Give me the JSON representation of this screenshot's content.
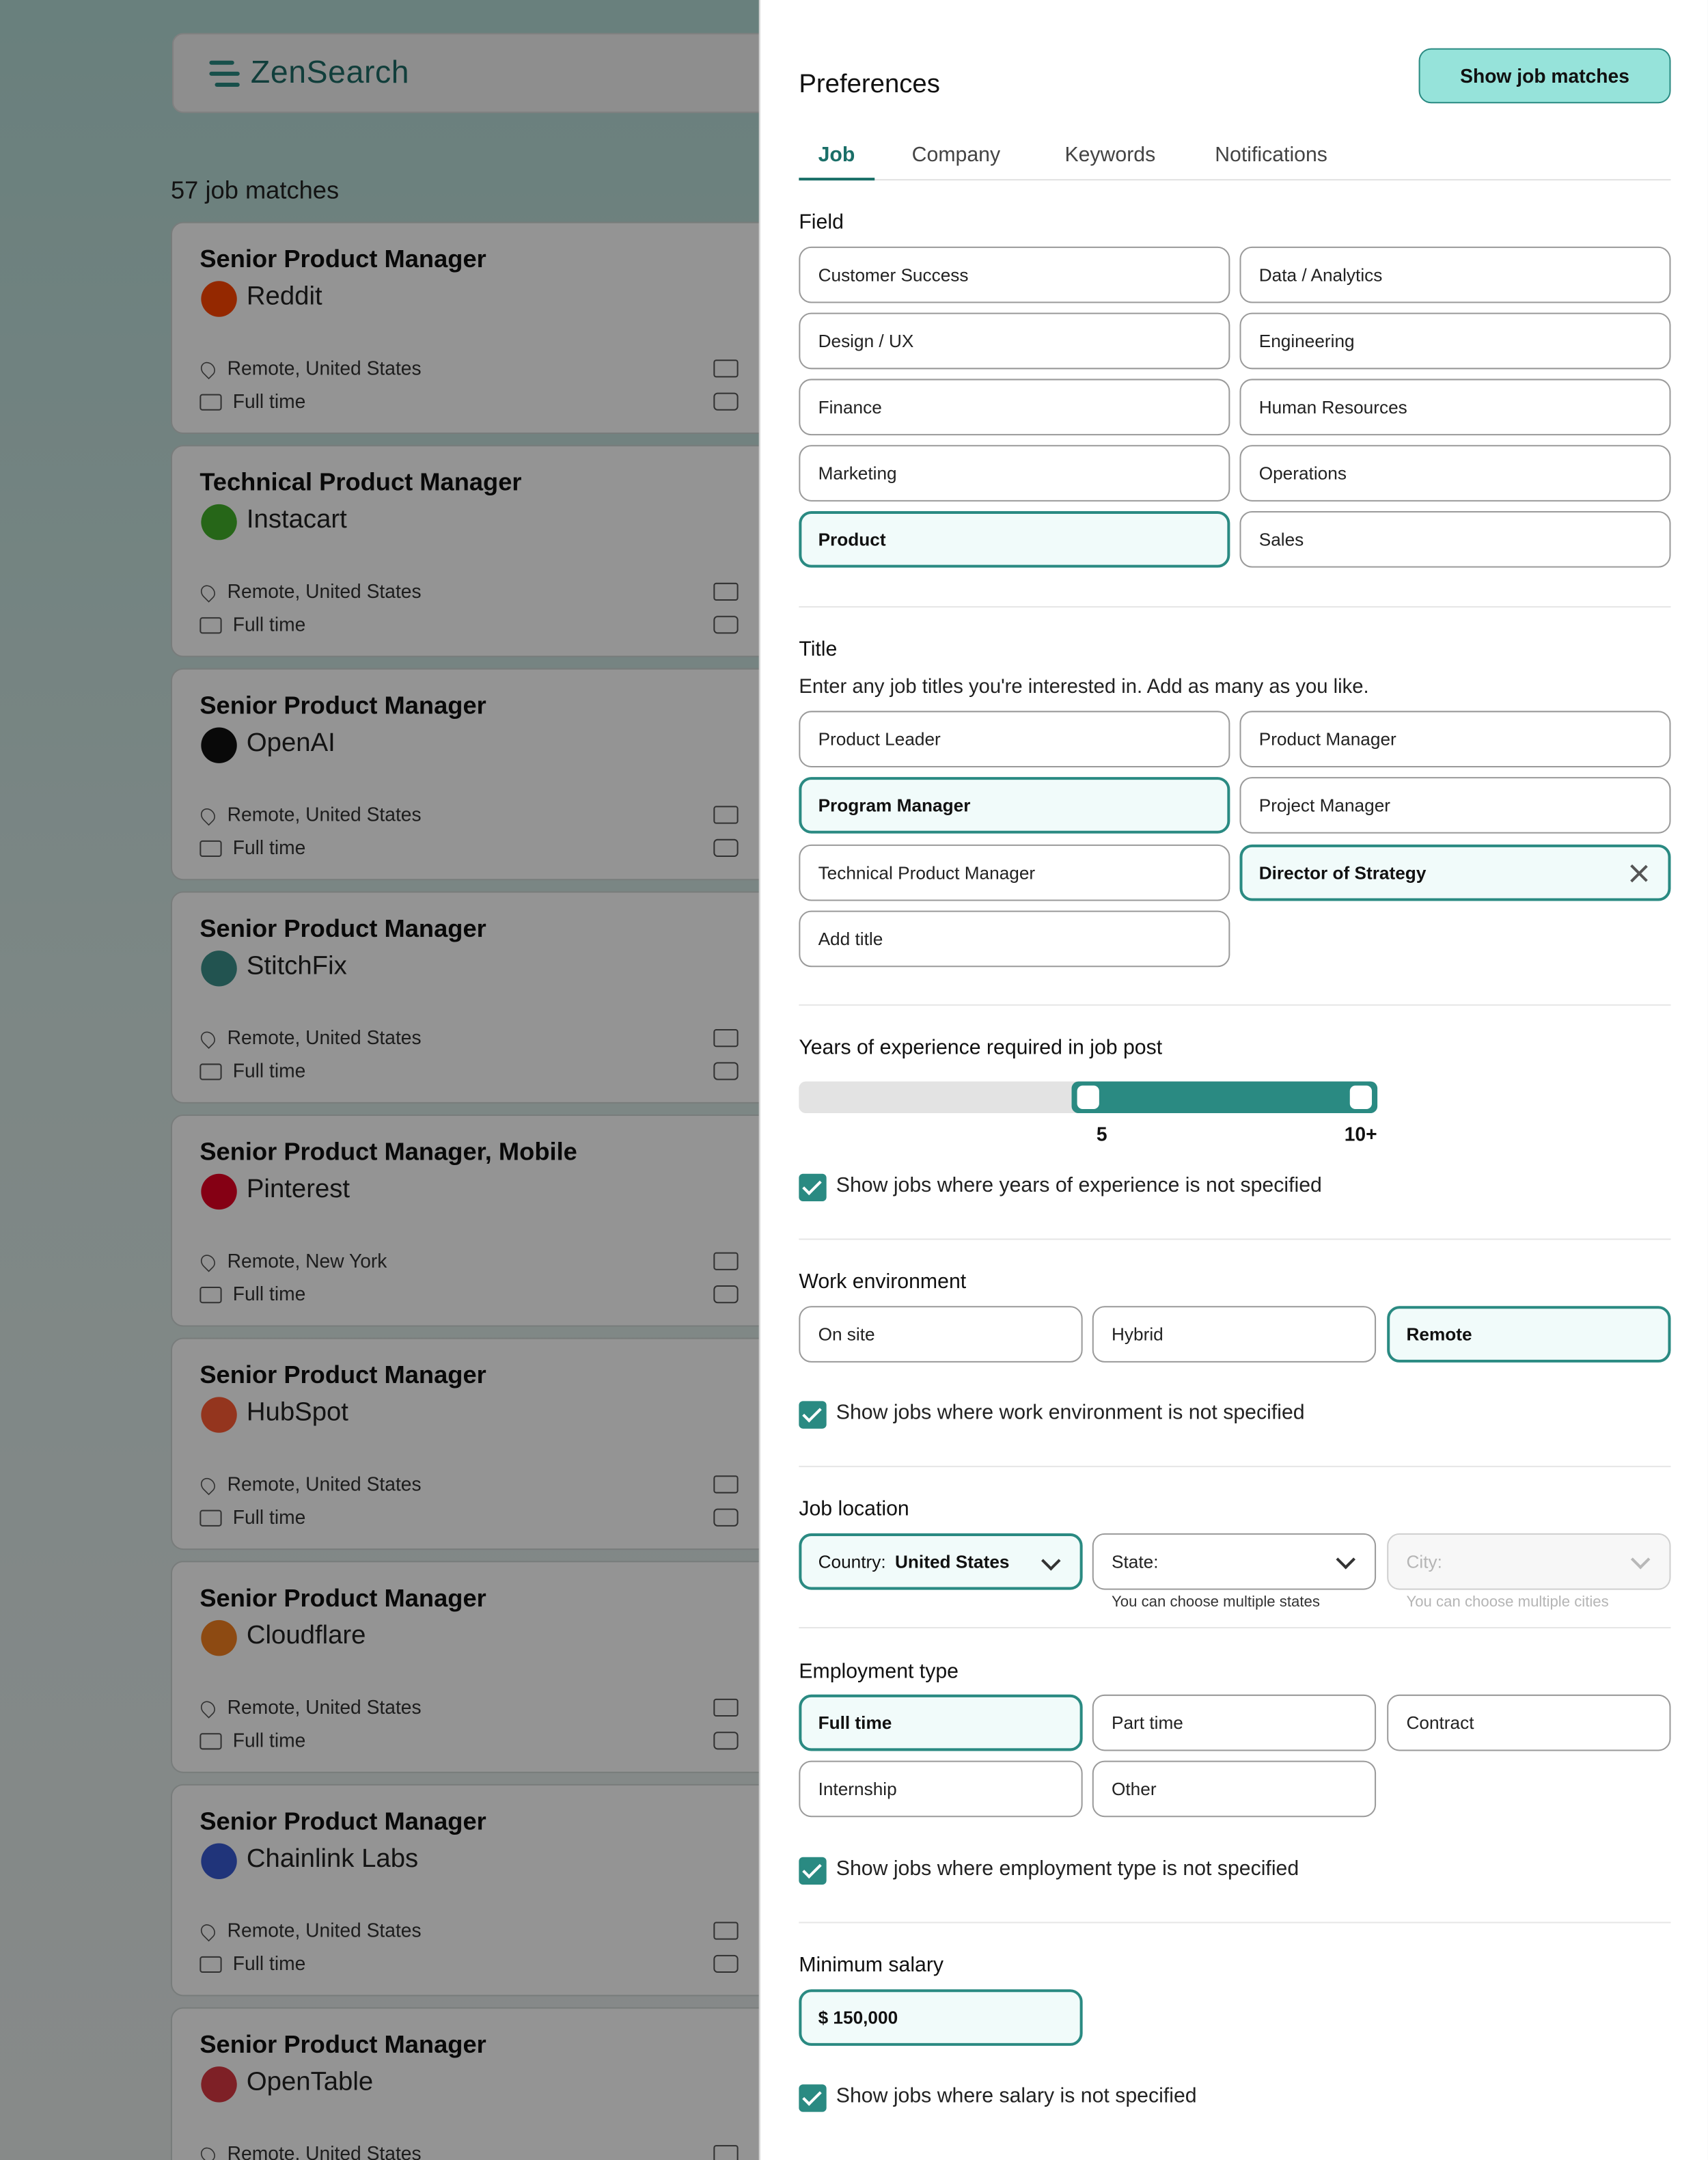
{
  "app": {
    "name": "ZenSearch"
  },
  "list": {
    "match_count": "57 job matches",
    "jobs": [
      {
        "title": "Senior Product Manager",
        "company": "Reddit",
        "location": "Remote, United States",
        "type": "Full time",
        "logo_color": "#ff4500"
      },
      {
        "title": "Technical Product Manager",
        "company": "Instacart",
        "location": "Remote, United States",
        "type": "Full time",
        "logo_color": "#43b02a"
      },
      {
        "title": "Senior Product Manager",
        "company": "OpenAI",
        "location": "Remote, United States",
        "type": "Full time",
        "logo_color": "#111111"
      },
      {
        "title": "Senior Product Manager",
        "company": "StitchFix",
        "location": "Remote, United States",
        "type": "Full time",
        "logo_color": "#3c8f8a"
      },
      {
        "title": "Senior Product Manager, Mobile",
        "company": "Pinterest",
        "location": "Remote, New York",
        "type": "Full time",
        "logo_color": "#e60023"
      },
      {
        "title": "Senior Product Manager",
        "company": "HubSpot",
        "location": "Remote, United States",
        "type": "Full time",
        "logo_color": "#ff5c35"
      },
      {
        "title": "Senior Product Manager",
        "company": "Cloudflare",
        "location": "Remote, United States",
        "type": "Full time",
        "logo_color": "#f38020"
      },
      {
        "title": "Senior Product Manager",
        "company": "Chainlink Labs",
        "location": "Remote, United States",
        "type": "Full time",
        "logo_color": "#375bd2"
      },
      {
        "title": "Senior Product Manager",
        "company": "OpenTable",
        "location": "Remote, United States",
        "type": "",
        "logo_color": "#da3743"
      }
    ]
  },
  "prefs": {
    "title": "Preferences",
    "show_matches_label": "Show job matches",
    "tabs": [
      "Job",
      "Company",
      "Keywords",
      "Notifications"
    ],
    "active_tab": "Job",
    "field": {
      "label": "Field",
      "options": [
        "Customer Success",
        "Data / Analytics",
        "Design / UX",
        "Engineering",
        "Finance",
        "Human Resources",
        "Marketing",
        "Operations",
        "Product",
        "Sales"
      ],
      "selected": [
        "Product"
      ]
    },
    "title_section": {
      "label": "Title",
      "description": "Enter any job titles you're interested in. Add as many as you like.",
      "options": [
        "Product Leader",
        "Product Manager",
        "Program Manager",
        "Project Manager",
        "Technical Product Manager",
        "Director of Strategy"
      ],
      "selected": [
        "Program Manager",
        "Director of Strategy"
      ],
      "add_placeholder": "Add title"
    },
    "experience": {
      "label": "Years of experience required in job post",
      "min_label": "5",
      "max_label": "10+",
      "range_min_fraction": 0.5,
      "range_max_fraction": 1.0,
      "unspecified_label": "Show jobs where years of experience is not specified",
      "unspecified_checked": true
    },
    "work_env": {
      "label": "Work environment",
      "options": [
        "On site",
        "Hybrid",
        "Remote"
      ],
      "selected": [
        "Remote"
      ],
      "unspecified_label": "Show jobs where work environment is not specified",
      "unspecified_checked": true
    },
    "location": {
      "label": "Job location",
      "country_prefix": "Country:",
      "country_value": "United States",
      "state_placeholder": "State:",
      "state_hint": "You can choose multiple states",
      "city_placeholder": "City:",
      "city_hint": "You can choose multiple cities"
    },
    "employment": {
      "label": "Employment type",
      "options": [
        "Full time",
        "Part time",
        "Contract",
        "Internship",
        "Other"
      ],
      "selected": [
        "Full time"
      ],
      "unspecified_label": "Show jobs where employment type is not specified",
      "unspecified_checked": true
    },
    "salary": {
      "label": "Minimum salary",
      "value": "$ 150,000",
      "unspecified_label": "Show jobs where salary is not specified",
      "unspecified_checked": true
    },
    "colors": {
      "accent": "#2a8a82",
      "accent_light": "#96e3da",
      "selected_bg": "#f1fbfa"
    }
  }
}
